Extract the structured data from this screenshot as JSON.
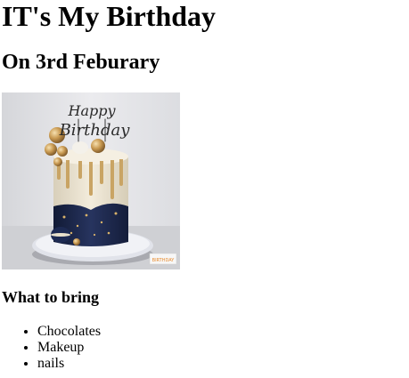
{
  "page": {
    "title": "IT's My Birthday",
    "subtitle": "On 3rd Feburary",
    "image": {
      "alt": "Birthday cake with Happy Birthday topper",
      "badge_text": "BIRTHDAY"
    },
    "bring_heading": "What to bring",
    "bring_items": [
      {
        "label": "Chocolates"
      },
      {
        "label": "Makeup"
      },
      {
        "label": "nails"
      }
    ]
  },
  "colors": {
    "background": "#ffffff",
    "text": "#000000",
    "cake_navy": "#1f2c52",
    "cake_cream": "#eae2cf",
    "cake_gold": "#c99a52"
  }
}
